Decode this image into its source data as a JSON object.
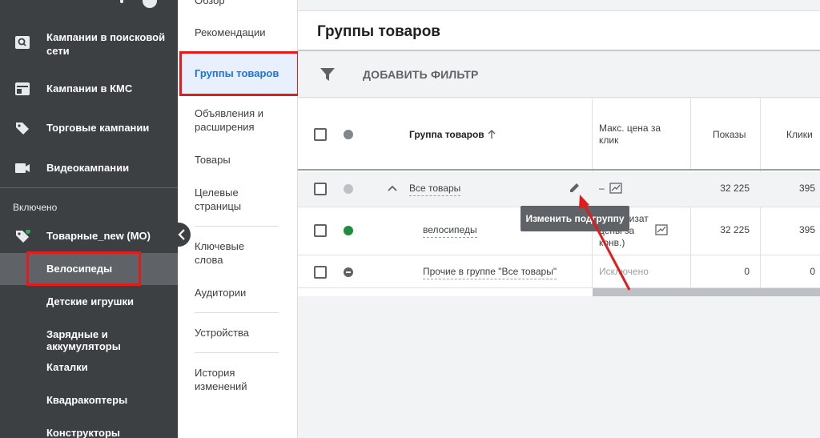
{
  "sidebar": {
    "items": [
      {
        "label": "Кампании в поисковой сети",
        "icon": "search-campaign-icon"
      },
      {
        "label": "Кампании в КМС",
        "icon": "display-campaign-icon"
      },
      {
        "label": "Торговые кампании",
        "icon": "shopping-tag-icon"
      },
      {
        "label": "Видеокампании",
        "icon": "video-camera-icon"
      }
    ],
    "section_label": "Включено",
    "campaign": {
      "label": "Товарные_new (МО)",
      "icon": "shopping-tag-icon",
      "status_color": "#34a853"
    },
    "subitems": [
      {
        "label": "Велосипеды"
      },
      {
        "label": "Детские игрушки"
      },
      {
        "label": "Зарядные и аккумуляторы"
      },
      {
        "label": "Каталки"
      },
      {
        "label": "Квадракоптеры"
      },
      {
        "label": "Конструкторы"
      }
    ],
    "collapse_icon": "chevron-left-icon"
  },
  "midnav": {
    "items": [
      {
        "label": "Обзор"
      },
      {
        "label": "Рекомендации"
      },
      {
        "label": "Группы товаров"
      },
      {
        "label": "Объявления и расширения"
      },
      {
        "label": "Товары"
      },
      {
        "label": "Целевые страницы"
      },
      {
        "label": "Ключевые слова"
      },
      {
        "label": "Аудитории"
      },
      {
        "label": "Устройства"
      },
      {
        "label": "История изменений"
      }
    ]
  },
  "main": {
    "title": "Группы товаров",
    "filter_label": "ДОБАВИТЬ ФИЛЬТР",
    "columns": {
      "group": "Группа товаров",
      "max_cpc": "Макс. цена за клик",
      "impressions": "Показы",
      "clicks": "Клики"
    },
    "rows": [
      {
        "name": "Все товары",
        "max_cpc": "–",
        "impressions": "32 225",
        "clicks": "395",
        "status_color": "#bdc1c6"
      },
      {
        "name": "велосипеды",
        "max_cpc": "(оптимизат цены за конв.)",
        "impressions": "32 225",
        "clicks": "395",
        "status_color": "#1e8e3e"
      },
      {
        "name": "Прочие в группе \"Все товары\"",
        "max_cpc": "Исключено",
        "impressions": "0",
        "clicks": "0",
        "status_color": "#5f6368"
      }
    ],
    "tooltip": "Изменить подгруппу"
  },
  "colors": {
    "annotation_red": "#e21b1b",
    "accent_blue": "#1a73e8",
    "sidebar_dark": "#3c4043"
  }
}
